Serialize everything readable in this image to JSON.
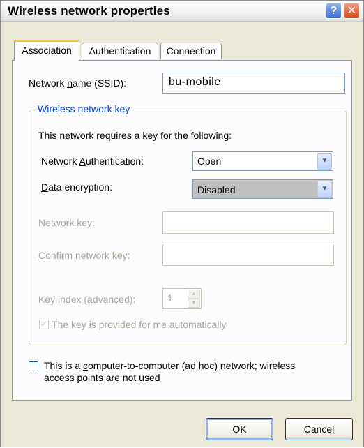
{
  "window": {
    "title": "Wireless network properties",
    "help_label": "?",
    "close_label": "✕"
  },
  "tabs": [
    {
      "label": "Association",
      "active": true
    },
    {
      "label": "Authentication",
      "active": false
    },
    {
      "label": "Connection",
      "active": false
    }
  ],
  "network_name": {
    "label_pre": "Network ",
    "label_key": "n",
    "label_post": "ame (SSID):",
    "value": "bu-mobile"
  },
  "wireless_key_group": {
    "legend": "Wireless network key",
    "description": "This network requires a key for the following:",
    "network_authentication": {
      "label_pre": "Network ",
      "label_key": "A",
      "label_post": "uthentication:",
      "value": "Open"
    },
    "data_encryption": {
      "label_key": "D",
      "label_post": "ata encryption:",
      "value": "Disabled"
    },
    "network_key": {
      "label_pre": "Network ",
      "label_key": "k",
      "label_post": "ey:",
      "value": ""
    },
    "confirm_key": {
      "label_key": "C",
      "label_pre": "",
      "label_post": "onfirm network key:",
      "value": ""
    },
    "key_index": {
      "label_pre": "Key inde",
      "label_key": "x",
      "label_post": " (advanced):",
      "value": "1"
    },
    "auto_key": {
      "label_pre": "",
      "label_key": "T",
      "label_post": "he key is provided for me automatically",
      "checked": true
    }
  },
  "adhoc": {
    "label_line1_pre": "This is a ",
    "label_line1_key": "c",
    "label_line1_post": "omputer-to-computer (ad hoc) network; wireless",
    "label_line2": "access points are not used",
    "checked": false
  },
  "buttons": {
    "ok": "OK",
    "cancel": "Cancel"
  },
  "icons": {
    "dropdown": "chevron-down-icon",
    "spinner_up": "triangle-up-icon",
    "spinner_down": "triangle-down-icon",
    "check": "checkmark-icon"
  },
  "colors": {
    "group_legend": "#0046d5",
    "active_tab_accent": "#ffc83c",
    "dialog_bg": "#ece9d8",
    "disabled_text": "#a7a69a"
  }
}
